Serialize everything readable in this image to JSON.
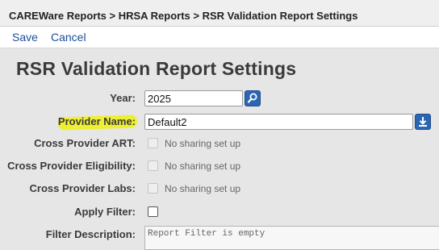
{
  "breadcrumb": "CAREWare Reports > HRSA Reports > RSR Validation Report Settings",
  "toolbar": {
    "save_label": "Save",
    "cancel_label": "Cancel"
  },
  "page_title": "RSR Validation Report Settings",
  "form": {
    "year": {
      "label": "Year:",
      "value": "2025",
      "icon": "search-icon"
    },
    "provider_name": {
      "label": "Provider Name:",
      "value": "Default2",
      "icon": "download-icon"
    },
    "cross_provider_art": {
      "label": "Cross Provider ART:",
      "note": "No sharing set up",
      "checked": false,
      "disabled": true
    },
    "cross_provider_eligibility": {
      "label": "Cross Provider Eligibility:",
      "note": "No sharing set up",
      "checked": false,
      "disabled": true
    },
    "cross_provider_labs": {
      "label": "Cross Provider Labs:",
      "note": "No sharing set up",
      "checked": false,
      "disabled": true
    },
    "apply_filter": {
      "label": "Apply Filter:",
      "checked": false
    },
    "filter_description": {
      "label": "Filter Description:",
      "value": "Report Filter is empty"
    }
  },
  "colors": {
    "accent": "#2b66b4",
    "link": "#1a4f9a",
    "highlight": "#eef01e",
    "background": "#e6e6e6"
  }
}
